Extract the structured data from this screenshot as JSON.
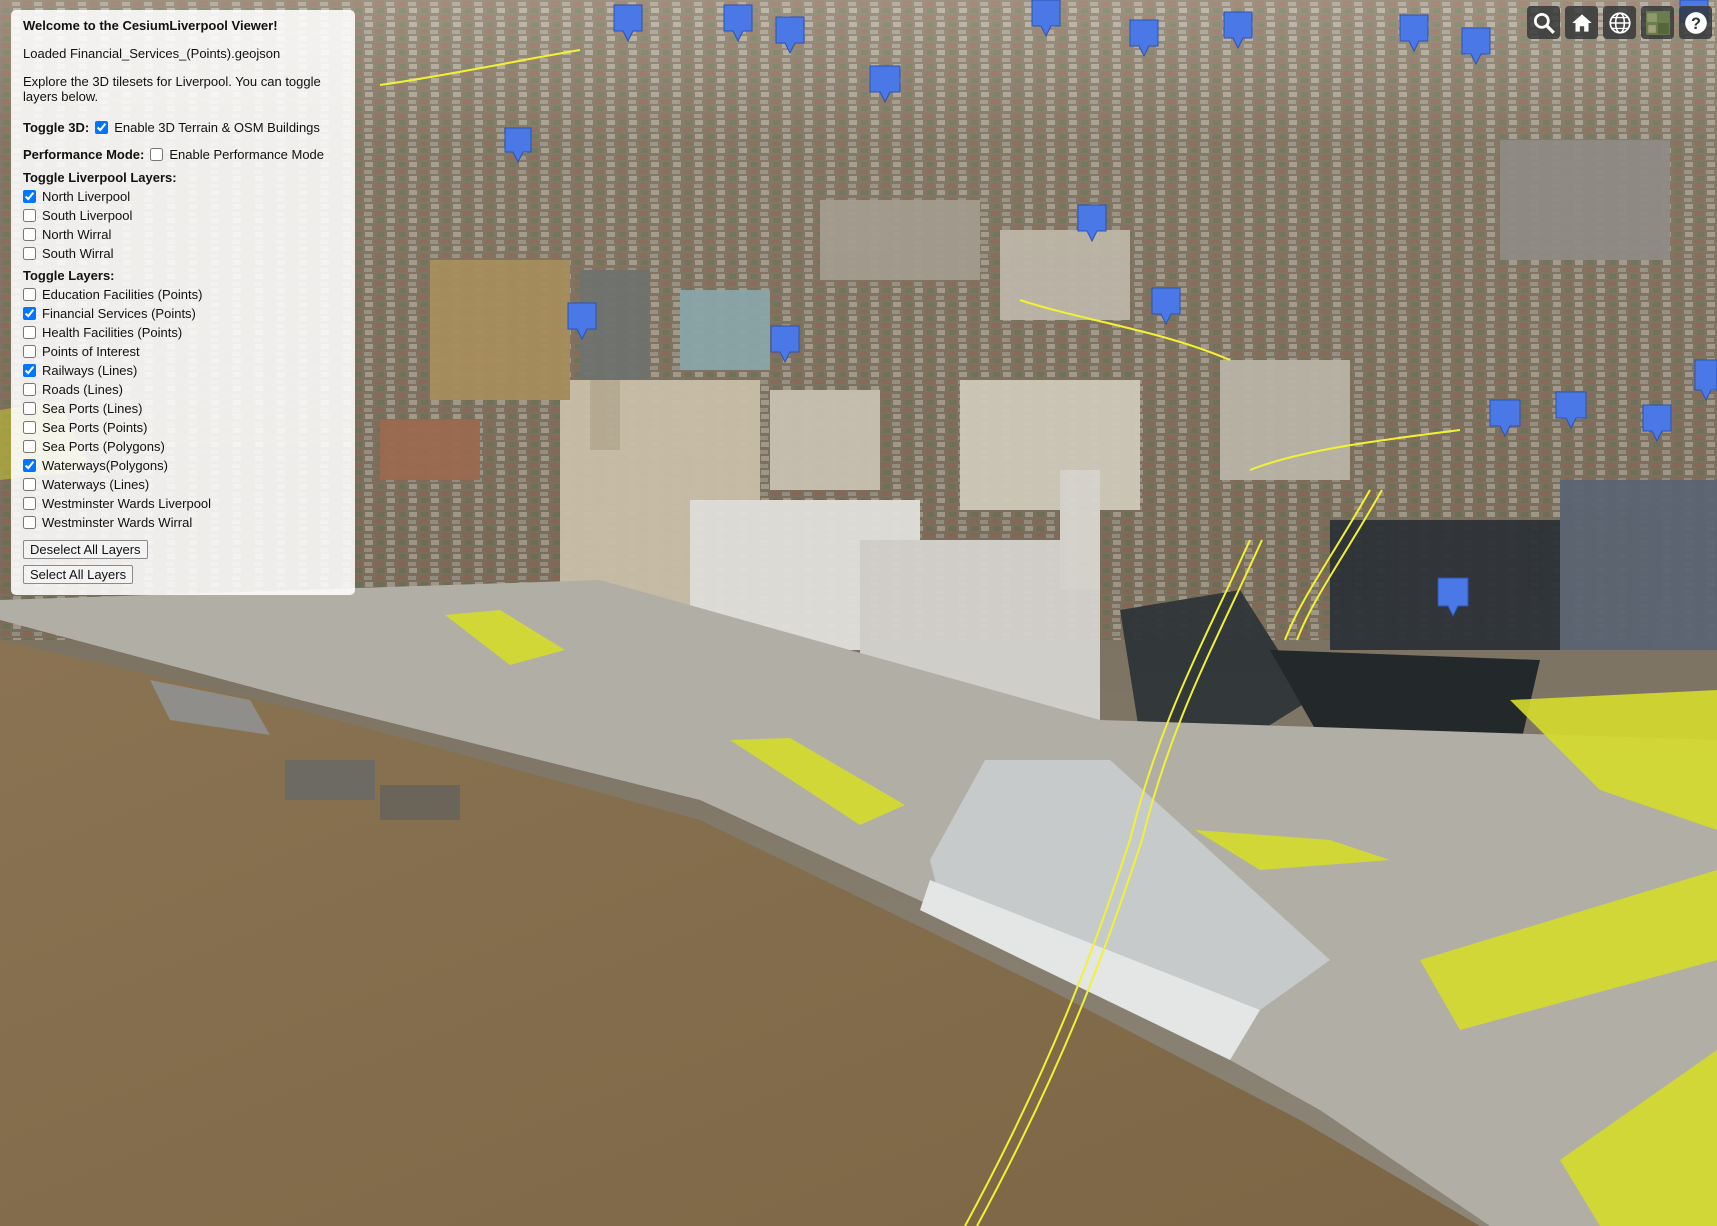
{
  "panel": {
    "title": "Welcome to the CesiumLiverpool Viewer!",
    "loaded_message": "Loaded Financial_Services_(Points).geojson",
    "description": "Explore the 3D tilesets for Liverpool. You can toggle layers below.",
    "toggle3d": {
      "label": "Toggle 3D:",
      "option": "Enable 3D Terrain & OSM Buildings",
      "checked": true
    },
    "performance": {
      "label": "Performance Mode:",
      "option": "Enable Performance Mode",
      "checked": false
    },
    "liverpool_layers": {
      "heading": "Toggle Liverpool Layers:",
      "items": [
        {
          "label": "North Liverpool",
          "checked": true
        },
        {
          "label": "South Liverpool",
          "checked": false
        },
        {
          "label": "North Wirral",
          "checked": false
        },
        {
          "label": "South Wirral",
          "checked": false
        }
      ]
    },
    "layers": {
      "heading": "Toggle Layers:",
      "items": [
        {
          "label": "Education Facilities (Points)",
          "checked": false
        },
        {
          "label": "Financial Services (Points)",
          "checked": true
        },
        {
          "label": "Health Facilities (Points)",
          "checked": false
        },
        {
          "label": "Points of Interest",
          "checked": false
        },
        {
          "label": "Railways (Lines)",
          "checked": true
        },
        {
          "label": "Roads (Lines)",
          "checked": false
        },
        {
          "label": "Sea Ports (Lines)",
          "checked": false
        },
        {
          "label": "Sea Ports (Points)",
          "checked": false
        },
        {
          "label": "Sea Ports (Polygons)",
          "checked": false
        },
        {
          "label": "Waterways(Polygons)",
          "checked": true
        },
        {
          "label": "Waterways (Lines)",
          "checked": false
        },
        {
          "label": "Westminster Wards Liverpool",
          "checked": false
        },
        {
          "label": "Westminster Wards Wirral",
          "checked": false
        }
      ]
    },
    "deselect_all": "Deselect All Layers",
    "select_all": "Select All Layers"
  },
  "toolbar": {
    "buttons": [
      "search-icon",
      "home-icon",
      "globe-icon",
      "base-layer-picker-icon",
      "help-icon"
    ]
  },
  "colors": {
    "river": "#8a7455",
    "city": "#7a6f5e",
    "marker": "#4a78e6",
    "waterway_polygon": "#d6dc2c",
    "railway_line": "#f2f233"
  }
}
